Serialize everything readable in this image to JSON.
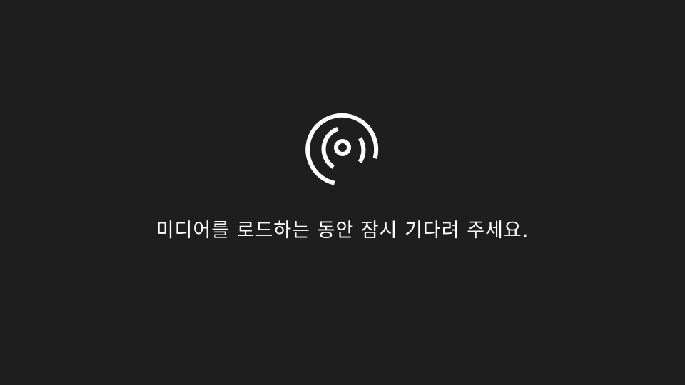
{
  "loading_screen": {
    "icon": "media-loading-disc-icon",
    "message": "미디어를 로드하는 동안 잠시 기다려 주세요."
  },
  "colors": {
    "background": "#1e1e1e",
    "foreground": "#ffffff"
  }
}
